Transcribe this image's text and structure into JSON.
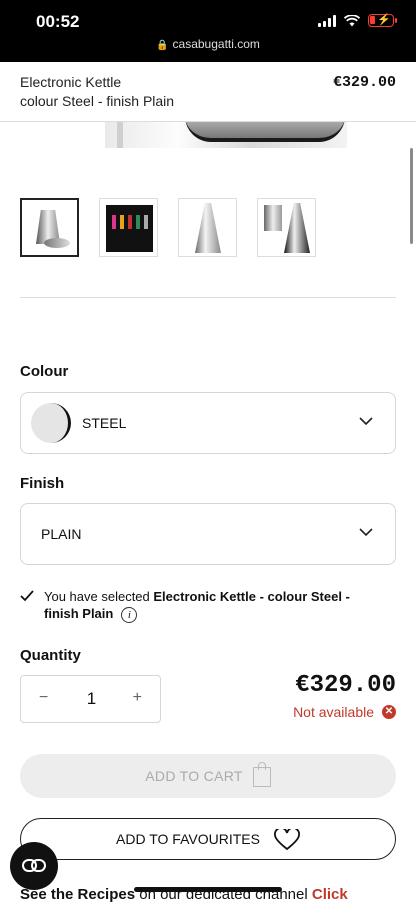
{
  "status_bar": {
    "time": "00:52",
    "url": "casabugatti.com"
  },
  "product_header": {
    "title_line1": "Electronic Kettle",
    "title_line2": "colour Steel - finish Plain",
    "price": "€329.00"
  },
  "gallery": {
    "thumbnails": [
      "kettle-with-cups",
      "kettle-dark-colors",
      "kettle-cone-steel",
      "kettle-with-pot"
    ],
    "active_index": 0
  },
  "options": {
    "colour_label": "Colour",
    "colour_value": "STEEL",
    "finish_label": "Finish",
    "finish_value": "PLAIN"
  },
  "selection": {
    "prefix": "You have selected ",
    "product": "Electronic Kettle - colour Steel - finish Plain"
  },
  "quantity": {
    "label": "Quantity",
    "minus": "−",
    "value": "1",
    "plus": "+"
  },
  "pricing": {
    "price": "€329.00",
    "availability": "Not available"
  },
  "actions": {
    "add_to_cart": "ADD TO CART",
    "add_to_favourites": "ADD TO FAVOURITES"
  },
  "footer": {
    "recipes_bold": "See the Recipes",
    "recipes_text": " on our dedicated channel ",
    "recipes_link": "Click"
  },
  "colors": {
    "accent": "#c0392b",
    "status_bar": "#000000",
    "battery": "#ff3b30"
  }
}
